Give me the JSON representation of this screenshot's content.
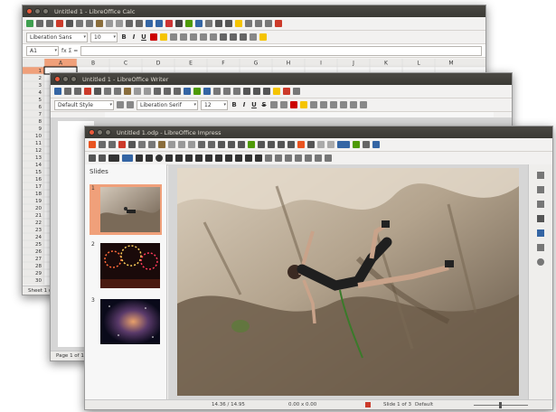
{
  "calc": {
    "title": "Untitled 1 - LibreOffice Calc",
    "font_name": "Liberation Sans",
    "font_size": "10",
    "cell_ref": "A1",
    "fx": "fx  Σ  =",
    "columns": [
      "A",
      "B",
      "C",
      "D",
      "E",
      "F",
      "G",
      "H",
      "I",
      "J",
      "K",
      "L",
      "M"
    ],
    "rows": [
      "1",
      "2",
      "3",
      "4",
      "5",
      "6",
      "7",
      "8",
      "9",
      "10",
      "11",
      "12",
      "13",
      "14",
      "15",
      "16",
      "17",
      "18",
      "19",
      "20",
      "21",
      "22",
      "23",
      "24",
      "25",
      "26",
      "27",
      "28",
      "29",
      "30"
    ],
    "sheet_tab": "Sheet 1 of 1"
  },
  "writer": {
    "title": "Untitled 1 - LibreOffice Writer",
    "style": "Default Style",
    "font_name": "Liberation Serif",
    "font_size": "12",
    "page_status": "Page 1 of 1"
  },
  "impress": {
    "title": "Untitled 1.odp - LibreOffice Impress",
    "slides_panel_title": "Slides",
    "slide_numbers": [
      "1",
      "2",
      "3"
    ],
    "status": {
      "position": "14.36 / 14.95",
      "size": "0.00 x 0.00",
      "slide": "Slide 1 of 3",
      "layout": "Default"
    }
  },
  "colors": {
    "titlebar": "#3c3b37",
    "close_button": "#e9593b",
    "toolbar_bg": "#f2f1f0",
    "selection": "#f0a07a",
    "accent_orange": "#e95420"
  }
}
